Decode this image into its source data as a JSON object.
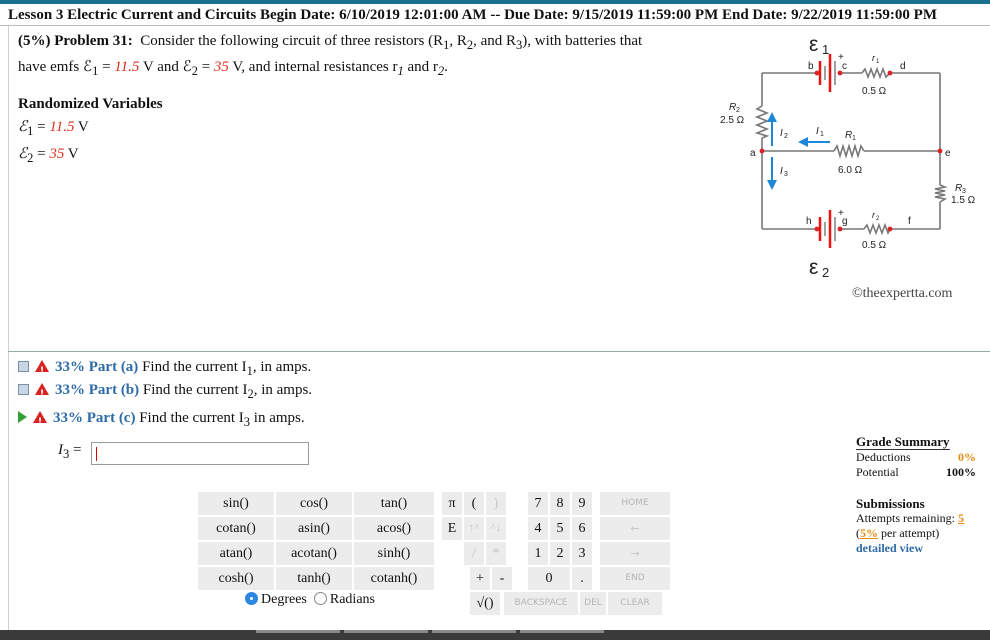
{
  "header": {
    "lesson": "Lesson 3 Electric Current and Circuits",
    "begin_label": "Begin Date:",
    "begin_date": "6/10/2019 12:01:00 AM",
    "due_label": "-- Due Date:",
    "due_date": "9/15/2019 11:59:00 PM",
    "end_label": "End Date:",
    "end_date": "9/22/2019 11:59:00 PM"
  },
  "problem": {
    "weight": "(5%)",
    "title": "Problem 31:",
    "text1": "Consider the following circuit of three resistors (R",
    "text2": ", R",
    "text3": ", and R",
    "text4": "), with batteries that",
    "text5": "have emfs ℰ",
    "text6": " = ",
    "emf1": "11.5",
    "text7": " V and ℰ",
    "text8": " = ",
    "emf2": "35",
    "text9": " V, and internal resistances r",
    "text10": " and r",
    "text11": "."
  },
  "randomized": {
    "title": "Randomized Variables",
    "var1_name": "ℰ",
    "var1_sub": "1",
    "var1_eq": " = ",
    "var1_value": "11.5",
    "var1_unit": " V",
    "var2_name": "ℰ",
    "var2_sub": "2",
    "var2_eq": " = ",
    "var2_value": "35",
    "var2_unit": " V"
  },
  "circuit": {
    "emf1_label": "ε",
    "emf1_sub": "1",
    "emf2_label": "ε",
    "emf2_sub": "2",
    "node_a": "a",
    "node_b": "b",
    "node_c": "c",
    "node_d": "d",
    "node_e": "e",
    "node_f": "f",
    "node_g": "g",
    "node_h": "h",
    "r1_label": "r",
    "r1_sub": "1",
    "r1_value": "0.5 Ω",
    "r2_label": "r",
    "r2_sub": "2",
    "r2_value": "0.5 Ω",
    "R1_label": "R",
    "R1_sub": "1",
    "R1_value": "6.0 Ω",
    "R2_label": "R",
    "R2_sub": "2",
    "R2_value": "2.5 Ω",
    "R3_label": "R",
    "R3_sub": "3",
    "R3_value": "1.5 Ω",
    "I1": "I",
    "I1_sub": "1",
    "I2": "I",
    "I2_sub": "2",
    "I3": "I",
    "I3_sub": "3",
    "plus": "+",
    "credit": "©theexpertta.com"
  },
  "parts": [
    {
      "pct": "33%",
      "label": "Part (a)",
      "text": "Find the current I",
      "sub": "1",
      "tail": ", in amps."
    },
    {
      "pct": "33%",
      "label": "Part (b)",
      "text": "Find the current I",
      "sub": "2",
      "tail": ", in amps."
    },
    {
      "pct": "33%",
      "label": "Part (c)",
      "text": "Find the current I",
      "sub": "3",
      "tail": " in amps."
    }
  ],
  "answer": {
    "label": "I",
    "sub": "3",
    "eq": " = ",
    "value": ""
  },
  "calculator": {
    "functions": [
      "sin()",
      "cos()",
      "tan()",
      "cotan()",
      "asin()",
      "acos()",
      "atan()",
      "acotan()",
      "sinh()",
      "cosh()",
      "tanh()",
      "cotanh()"
    ],
    "keys": {
      "pi": "π",
      "lparen": "(",
      "rparen": ")",
      "E": "E",
      "up": "↑^",
      "down": "^↓",
      "slash": "/",
      "star": "*",
      "plus": "+",
      "minus": "-",
      "sqrt": "√()",
      "seven": "7",
      "eight": "8",
      "nine": "9",
      "four": "4",
      "five": "5",
      "six": "6",
      "one": "1",
      "two": "2",
      "three": "3",
      "zero": "0",
      "dot": ".",
      "home": "HOME",
      "left": "←",
      "right": "→",
      "end": "END",
      "backspace": "BACKSPACE",
      "del": "DEL",
      "clear": "CLEAR"
    },
    "degrees": "Degrees",
    "radians": "Radians",
    "mode": "Degrees"
  },
  "grade": {
    "title": "Grade Summary",
    "deductions_label": "Deductions",
    "deductions_value": "0%",
    "potential_label": "Potential",
    "potential_value": "100%"
  },
  "submissions": {
    "title": "Submissions",
    "attempts_label": "Attempts remaining: ",
    "attempts_value": "5",
    "per_pre": "(",
    "per_value": "5%",
    "per_post": " per attempt)",
    "detailed": "detailed view"
  },
  "colors": {
    "accent": "#2d6ba8",
    "red": "#e0301e",
    "orange": "#e78b12",
    "top_strip": "#1b6f8f"
  }
}
